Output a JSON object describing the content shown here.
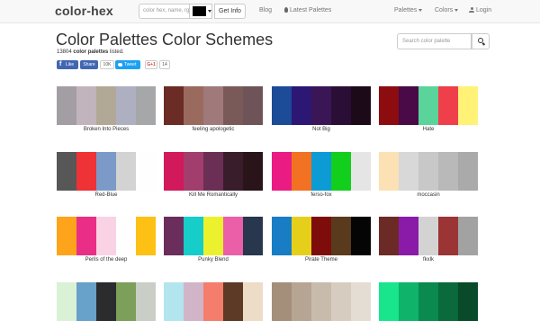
{
  "nav": {
    "brand": "color-hex",
    "search_placeholder": "color hex, name, rgb, h",
    "swatch_color": "#000000",
    "getinfo_label": "Get Info",
    "blog_label": "Blog",
    "latest_label": "Latest Palettes",
    "palettes_label": "Palettes",
    "colors_label": "Colors",
    "login_label": "Login"
  },
  "page": {
    "title": "Color Palettes Color Schemes",
    "count": "13804",
    "count_bold": "color palettes",
    "count_suffix": " listed.",
    "search_placeholder": "Search color palette"
  },
  "social": {
    "like": "Like",
    "share": "Share",
    "fb_count": "10K",
    "tweet": "Tweet",
    "gplus": "G+1",
    "gplus_count": "14"
  },
  "palettes": [
    {
      "name": "Broken Into Pieces",
      "colors": [
        "#a39ea4",
        "#c2b4bd",
        "#b2a896",
        "#aeb0c1",
        "#a6a7a8"
      ]
    },
    {
      "name": "feeling apologetic",
      "colors": [
        "#6a2c24",
        "#9a6a5e",
        "#a07a7a",
        "#7a5a58",
        "#6e5458"
      ]
    },
    {
      "name": "Not Big",
      "colors": [
        "#1c4b97",
        "#2c1774",
        "#3a1656",
        "#2b0e36",
        "#1d0a18"
      ]
    },
    {
      "name": "Hate",
      "colors": [
        "#8c0c10",
        "#4a0a48",
        "#5ad49a",
        "#ee3f4a",
        "#fff276"
      ]
    },
    {
      "name": "Red-Blue",
      "colors": [
        "#575757",
        "#ee3236",
        "#7b9ac8",
        "#d3d3d3",
        "#fefefe"
      ]
    },
    {
      "name": "Kill Me Romantically",
      "colors": [
        "#d2195b",
        "#a23e6e",
        "#6b2f56",
        "#3a1d2b",
        "#29141a"
      ]
    },
    {
      "name": "ferso-fox",
      "colors": [
        "#ea1c84",
        "#f27123",
        "#0d9bd5",
        "#13cf1d",
        "#e5e5e5"
      ]
    },
    {
      "name": "moccasin",
      "colors": [
        "#fbe1b3",
        "#d8d8d8",
        "#c8c8c8",
        "#b9b9b9",
        "#aaaaaa"
      ]
    },
    {
      "name": "Perils of the deep",
      "colors": [
        "#fea41b",
        "#ea2d86",
        "#f9d2e4",
        "#fefefe",
        "#fdc014"
      ]
    },
    {
      "name": "Punky Blend",
      "colors": [
        "#6b2d5b",
        "#16cdca",
        "#ecf12e",
        "#ea5fa8",
        "#28364e"
      ]
    },
    {
      "name": "Pirate Theme",
      "colors": [
        "#187dc5",
        "#e6cf1b",
        "#7d0c0a",
        "#5a3a1c",
        "#050505"
      ]
    },
    {
      "name": "fkxlk",
      "colors": [
        "#6b2a26",
        "#8a1ba8",
        "#d3d3d3",
        "#9b3434",
        "#a2a2a2"
      ]
    },
    {
      "name": "",
      "colors": [
        "#d9f1d5",
        "#68a1c9",
        "#2b2c2e",
        "#7ca05a",
        "#c9cfc6"
      ]
    },
    {
      "name": "",
      "colors": [
        "#b3e5ee",
        "#d2b4c9",
        "#f47d6c",
        "#5d3a25",
        "#ecdcc8"
      ]
    },
    {
      "name": "",
      "colors": [
        "#a48f7a",
        "#b7a593",
        "#c8bbab",
        "#d6cdc0",
        "#e4ddd3"
      ]
    },
    {
      "name": "",
      "colors": [
        "#18e58c",
        "#0fb36a",
        "#0a8a4e",
        "#0a6a3c",
        "#084a2a"
      ]
    }
  ]
}
